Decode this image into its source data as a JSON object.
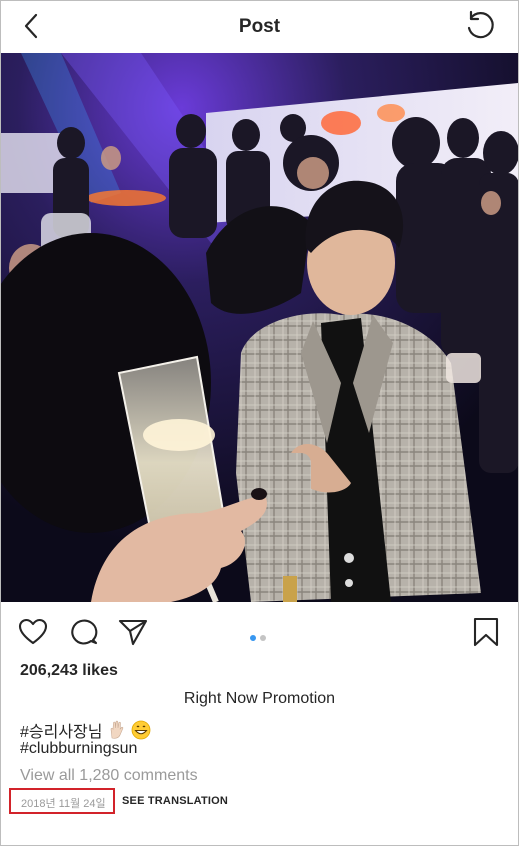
{
  "header": {
    "title": "Post",
    "back_icon": "chevron-left-icon",
    "refresh_icon": "refresh-icon"
  },
  "post": {
    "likes": "206,243 likes",
    "caption_title": "Right Now Promotion",
    "hashtag_1": "#승리사장님",
    "hashtag_2": "#clubburningsun",
    "view_comments": "View all 1,280 comments",
    "date": "2018년 11월 24일",
    "see_translation": "SEE TRANSLATION",
    "carousel_total": 2,
    "carousel_active": 1
  },
  "actions": {
    "like_icon": "heart-icon",
    "comment_icon": "comment-icon",
    "share_icon": "paper-plane-icon",
    "save_icon": "bookmark-icon"
  },
  "colors": {
    "accent": "#3897f0",
    "highlight_box": "#d2232a",
    "muted_text": "#9a9a9a"
  }
}
